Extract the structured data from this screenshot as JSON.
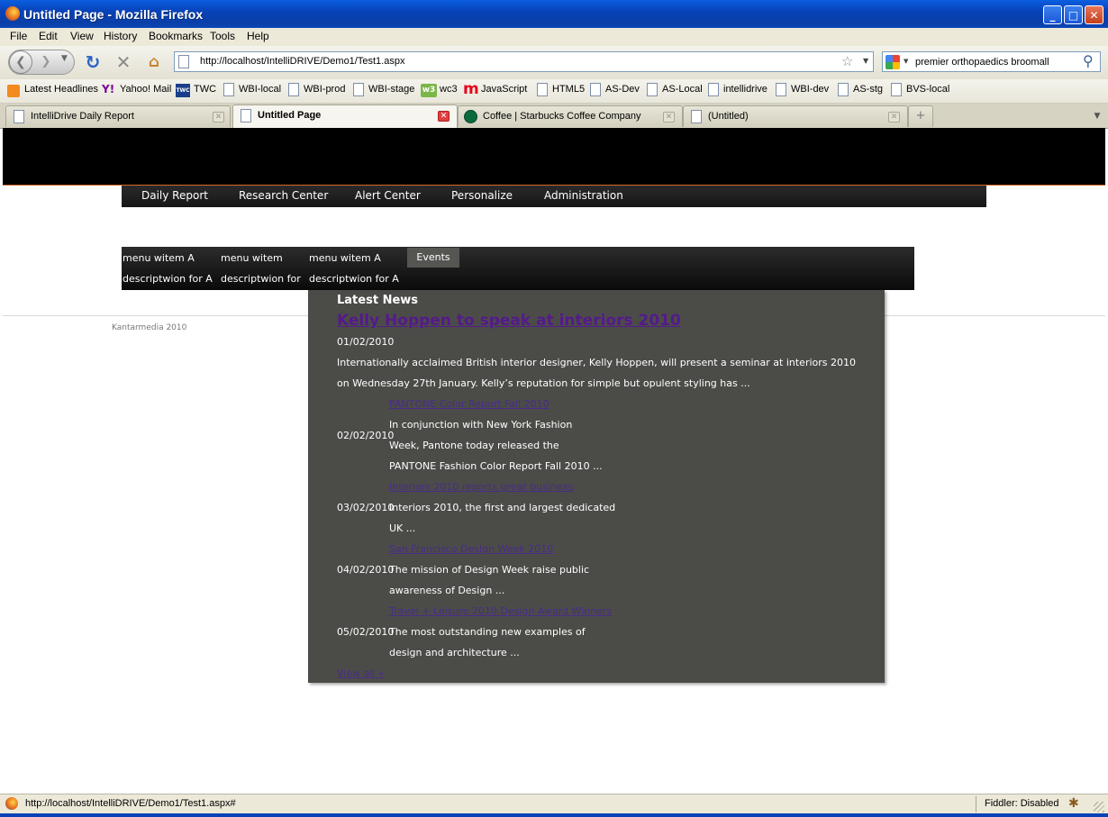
{
  "window": {
    "title": "Untitled Page - Mozilla Firefox"
  },
  "menubar": [
    "File",
    "Edit",
    "View",
    "History",
    "Bookmarks",
    "Tools",
    "Help"
  ],
  "navbar": {
    "url": "http://localhost/IntelliDRIVE/Demo1/Test1.aspx",
    "search_value": "premier orthopaedics broomall"
  },
  "bookmarks": [
    "Latest Headlines",
    "Yahoo! Mail",
    "TWC",
    "WBI-local",
    "WBI-prod",
    "WBI-stage",
    "wc3",
    "JavaScript",
    "HTML5",
    "AS-Dev",
    "AS-Local",
    "intellidrive",
    "WBI-dev",
    "AS-stg",
    "BVS-local"
  ],
  "bookmark_icons": {
    "yahoo": "Y!",
    "twc": "TWC",
    "w3": "w3",
    "m": "m"
  },
  "tabs": [
    {
      "label": "IntelliDrive Daily Report",
      "active": false
    },
    {
      "label": "Untitled Page",
      "active": true
    },
    {
      "label": "Coffee | Starbucks Coffee Company",
      "active": false
    },
    {
      "label": "(Untitled)",
      "active": false
    }
  ],
  "page": {
    "topnav": [
      "Daily Report",
      "Research Center",
      "Alert Center",
      "Personalize",
      "Administration"
    ],
    "submenu": {
      "items": [
        "menu witem A",
        "menu witem",
        "menu witem A"
      ],
      "descriptions": [
        "descriptwion for A",
        "descriptwion for",
        "descriptwion for A"
      ],
      "events_label": "Events"
    },
    "footer": "Kantarmedia 2010",
    "news": {
      "title": "Latest News",
      "headline": "Kelly Hoppen to speak at interiors 2010",
      "headline_date": "01/02/2010",
      "headline_text_1": "Internationally acclaimed British interior designer, Kelly Hoppen, will present a seminar at interiors 2010",
      "headline_text_2": "on Wednesday 27th January. Kelly’s reputation for simple but opulent styling has ...",
      "items": [
        {
          "link": "PANTONE Color Report Fall 2010",
          "date": "02/02/2010",
          "lines": [
            "In conjunction with New York Fashion",
            "Week, Pantone today released the",
            "PANTONE Fashion Color Report Fall 2010 ..."
          ]
        },
        {
          "link": "Interiors 2010 reports great business",
          "date": "03/02/2010",
          "lines": [
            "Interiors 2010, the first and largest dedicated",
            "UK ..."
          ]
        },
        {
          "link": "San Francisco Design Week 2010",
          "date": "04/02/2010",
          "lines": [
            "The mission of Design Week raise public",
            "awareness of Design ..."
          ]
        },
        {
          "link": "Travel + Leisure 2010 Design Award Winners",
          "date": "05/02/2010",
          "lines": [
            "The most outstanding new examples of",
            "design and architecture ..."
          ]
        }
      ],
      "view_all": "View all »"
    }
  },
  "statusbar": {
    "text": "http://localhost/IntelliDRIVE/Demo1/Test1.aspx#",
    "fiddler": "Fiddler: Disabled"
  },
  "colors": {
    "titlebar": "#0842b8",
    "news_bg": "#4b4c48",
    "visited_link": "#551a8b",
    "nav_bg": "#161616"
  }
}
